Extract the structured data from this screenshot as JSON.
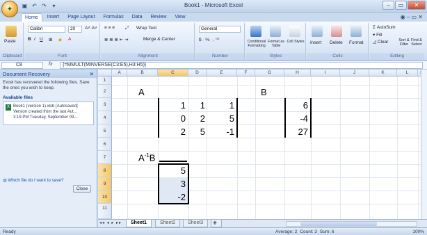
{
  "window": {
    "title": "Book1 - Microsoft Excel",
    "controls": [
      "–",
      "▭",
      "✕"
    ]
  },
  "ribbon_tabs": [
    "Home",
    "Insert",
    "Page Layout",
    "Formulas",
    "Data",
    "Review",
    "View"
  ],
  "ribbon": {
    "clipboard": {
      "paste": "Paste",
      "label": "Clipboard"
    },
    "font": {
      "name": "Calibri",
      "size": "20",
      "label": "Font"
    },
    "alignment": {
      "wrap": "Wrap Text",
      "merge": "Merge & Center",
      "label": "Alignment"
    },
    "number": {
      "format": "General",
      "label": "Number"
    },
    "styles": {
      "conditional": "Conditional Formatting",
      "format_as": "Format as Table",
      "cell": "Cell Styles",
      "label": "Styles"
    },
    "cells": {
      "insert": "Insert",
      "delete": "Delete",
      "format": "Format",
      "label": "Cells"
    },
    "editing": {
      "autosum": "AutoSum",
      "fill": "Fill",
      "clear": "Clear",
      "sort": "Sort & Filter",
      "find": "Find & Select",
      "label": "Editing"
    }
  },
  "formula_bar": {
    "name_box": "C8",
    "fx": "fx",
    "formula": "{=MMULT(MINVERSE(C3:E5),H3:H5)}"
  },
  "recovery": {
    "title": "Document Recovery",
    "message": "Excel has recovered the following files. Save the ones you wish to keep.",
    "available": "Available files",
    "file_name": "Book1 (version 1).xlsb [Autosaved]",
    "file_version": "Version created from the last Aut...",
    "file_time": "3:19 PM Tuesday, September 09,...",
    "which_file": "Which file do I want to save?",
    "close": "Close"
  },
  "columns": [
    "A",
    "B",
    "C",
    "D",
    "E",
    "F",
    "G",
    "H",
    "I",
    "J",
    "K",
    "L",
    "M"
  ],
  "rows": [
    "1",
    "2",
    "3",
    "4",
    "5",
    "6",
    "7",
    "8",
    "9",
    "10",
    "11"
  ],
  "cells": {
    "B2": "A",
    "G2": "B",
    "C3": "1",
    "D3": "1",
    "E3": "1",
    "C4": "0",
    "D4": "2",
    "E4": "5",
    "C5": "2",
    "D5": "5",
    "E5": "-1",
    "H3": "6",
    "H4": "-4",
    "H5": "27",
    "B7_main": "A",
    "B7_sup": "-1",
    "B7_tail": "B",
    "C8": "5",
    "C9": "3",
    "C10": "-2"
  },
  "sheet_tabs": [
    "Sheet1",
    "Sheet2",
    "Sheet3"
  ],
  "status": {
    "ready": "Ready",
    "average": "Average: 2",
    "count": "Count: 3",
    "sum": "Sum: 6",
    "zoom": "100%"
  }
}
